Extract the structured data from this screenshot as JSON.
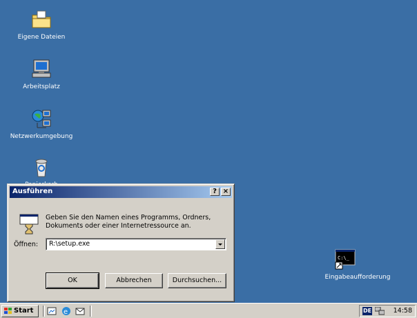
{
  "desktop": {
    "icons": [
      {
        "label": "Eigene Dateien",
        "icon": "folder-icon"
      },
      {
        "label": "Arbeitsplatz",
        "icon": "computer-icon"
      },
      {
        "label": "Netzwerkumgebung",
        "icon": "network-icon"
      },
      {
        "label": "Papierkorb",
        "icon": "recycle-bin-icon"
      },
      {
        "label": "Eingabeaufforderung",
        "icon": "command-prompt-icon",
        "icon_text": "C:\\_"
      }
    ]
  },
  "dialog": {
    "title": "Ausführen",
    "help_button": "?",
    "close_button": "×",
    "description": "Geben Sie den Namen eines Programms, Ordners, Dokuments oder einer Internetressource an.",
    "open_label": "Öffnen:",
    "open_value": "R:\\setup.exe",
    "buttons": {
      "ok": "OK",
      "cancel": "Abbrechen",
      "browse": "Durchsuchen..."
    }
  },
  "taskbar": {
    "start_label": "Start",
    "language": "DE",
    "clock": "14:58"
  },
  "colors": {
    "desktop": "#3A6EA5",
    "titlebar": "#0A246A",
    "face": "#D4D0C8"
  }
}
